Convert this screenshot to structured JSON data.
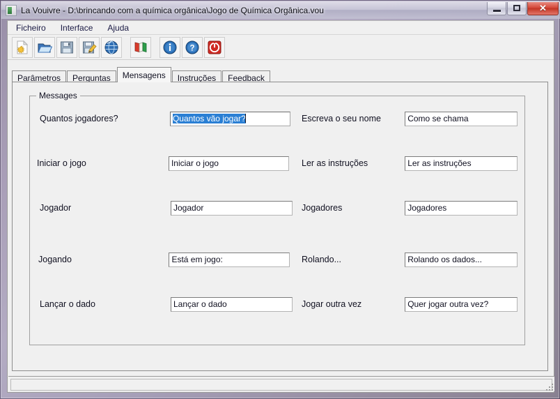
{
  "window": {
    "title": "La Vouivre - D:\\brincando com a química orgânica\\Jogo de Química Orgânica.vou",
    "icon": "app-icon",
    "controls": {
      "minimize": "–",
      "maximize": "□",
      "close": "✕"
    }
  },
  "menu": {
    "items": [
      {
        "label": "Ficheiro"
      },
      {
        "label": "Interface"
      },
      {
        "label": "Ajuda"
      }
    ]
  },
  "toolbar": {
    "buttons": [
      {
        "name": "new-document-icon",
        "tooltip": "Novo"
      },
      {
        "name": "open-folder-icon",
        "tooltip": "Abrir"
      },
      {
        "name": "save-icon",
        "tooltip": "Guardar"
      },
      {
        "name": "save-as-icon",
        "tooltip": "Guardar como"
      },
      {
        "name": "globe-icon",
        "tooltip": "Web"
      },
      {
        "name": "language-flags-icon",
        "tooltip": "Idioma"
      },
      {
        "name": "info-icon",
        "tooltip": "Informação"
      },
      {
        "name": "help-icon",
        "tooltip": "Ajuda"
      },
      {
        "name": "exit-icon",
        "tooltip": "Sair"
      }
    ]
  },
  "tabs": {
    "active_index": 2,
    "items": [
      {
        "label": "Parâmetros"
      },
      {
        "label": "Perguntas"
      },
      {
        "label": "Mensagens"
      },
      {
        "label": "Instruções"
      },
      {
        "label": "Feedback"
      }
    ]
  },
  "groupbox": {
    "title": "Messages"
  },
  "messages": {
    "left": [
      {
        "label": "Quantos jogadores?",
        "value": "Quantos vão jogar?",
        "focused": true,
        "selected": true
      },
      {
        "label": "Iniciar o jogo",
        "value": "Iniciar o jogo",
        "focused": false,
        "selected": false
      },
      {
        "label": "Jogador",
        "value": "Jogador",
        "focused": false,
        "selected": false
      },
      {
        "label": "Jogando",
        "value": "Está em jogo:",
        "focused": false,
        "selected": false
      },
      {
        "label": "Lançar o dado",
        "value": "Lançar o dado",
        "focused": false,
        "selected": false
      }
    ],
    "right": [
      {
        "label": "Escreva o seu nome",
        "value": "Como se chama",
        "focused": false,
        "selected": false
      },
      {
        "label": "Ler as instruções",
        "value": "Ler as instruções",
        "focused": false,
        "selected": false
      },
      {
        "label": "Jogadores",
        "value": "Jogadores",
        "focused": false,
        "selected": false
      },
      {
        "label": "Rolando...",
        "value": "Rolando os dados...",
        "focused": false,
        "selected": false
      },
      {
        "label": "Jogar outra vez",
        "value": "Quer jogar outra vez?",
        "focused": false,
        "selected": false
      }
    ]
  },
  "statusbar": {
    "text": ""
  },
  "colors": {
    "selection": "#2a7fd4",
    "window_face": "#f0f0f0",
    "close_button": "#c23525",
    "title_text": "#0a0a12"
  }
}
